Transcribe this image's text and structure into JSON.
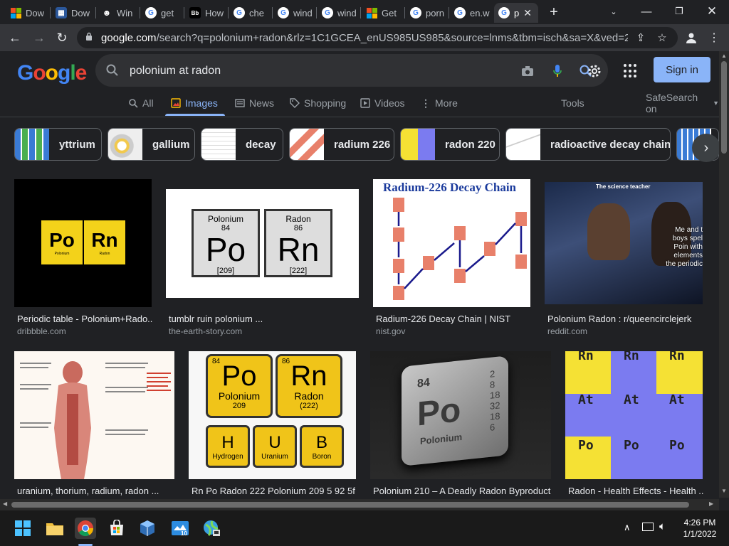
{
  "tabs": [
    {
      "label": "Dow",
      "icon": "windows-icon"
    },
    {
      "label": "Dow",
      "icon": "windows-icon"
    },
    {
      "label": "Win",
      "icon": "spy-icon"
    },
    {
      "label": "get",
      "icon": "google-icon"
    },
    {
      "label": "How",
      "icon": "bb-icon"
    },
    {
      "label": "che",
      "icon": "google-icon"
    },
    {
      "label": "wind",
      "icon": "google-icon"
    },
    {
      "label": "wind",
      "icon": "google-icon"
    },
    {
      "label": "Get",
      "icon": "microsoft-icon"
    },
    {
      "label": "porn",
      "icon": "google-icon"
    },
    {
      "label": "en.w",
      "icon": "google-icon"
    },
    {
      "label": "p",
      "icon": "google-icon"
    }
  ],
  "address": {
    "host": "google.com",
    "path": "/search?q=polonium+radon&rlz=1C1GCEA_enUS985US985&source=lnms&tbm=isch&sa=X&ved=2ahU..."
  },
  "search": {
    "query": "polonium at radon"
  },
  "logo": "Google",
  "signin_label": "Sign in",
  "nav": {
    "tabs": [
      "All",
      "Images",
      "News",
      "Shopping",
      "Videos",
      "More"
    ],
    "tools": "Tools",
    "safesearch": "SafeSearch on"
  },
  "chips": [
    "yttrium",
    "gallium",
    "decay",
    "radium 226",
    "radon 220",
    "radioactive decay chain"
  ],
  "results": [
    {
      "title": "Periodic table - Polonium+Rado...",
      "source": "dribbble.com"
    },
    {
      "title": "tumblr ruin polonium ...",
      "source": "the-earth-story.com"
    },
    {
      "title": "Radium-226 Decay Chain | NIST",
      "source": "nist.gov"
    },
    {
      "title": "Polonium Radon : r/queencirclejerk",
      "source": "reddit.com"
    },
    {
      "title": "uranium, thorium, radium, radon ...",
      "source": ""
    },
    {
      "title": "Rn Po Radon 222 Polonium 209 5 92 5f ...",
      "source": ""
    },
    {
      "title": "Polonium 210 – A Deadly Radon Byproduct",
      "source": ""
    },
    {
      "title": "Radon - Health Effects - Health ...",
      "source": ""
    }
  ],
  "images": {
    "dribbble": {
      "el1": "Po",
      "el2": "Rn",
      "n1": "Polonium",
      "n2": "Radon"
    },
    "tumblr": {
      "name1": "Polonium",
      "num1": "84",
      "sym1": "Po",
      "mass1": "[209]",
      "name2": "Radon",
      "num2": "86",
      "sym2": "Rn",
      "mass2": "[222]"
    },
    "nist": {
      "title": "Radium-226 Decay Chain"
    },
    "reddit": {
      "caption": "The science teacher",
      "overlay": "Me and t boys spel Poin with elements the periodic"
    },
    "tiles": {
      "po": "Po",
      "polonium": "Polonium",
      "po_mass": "209",
      "rn": "Rn",
      "radon": "Radon",
      "rn_mass": "(222)",
      "h": "H",
      "hydrogen": "Hydrogen",
      "u": "U",
      "uranium": "Uranium",
      "b": "B",
      "boron": "Boron",
      "po_num": "84",
      "rn_num": "86"
    },
    "cube": {
      "num": "84",
      "sym": "Po",
      "name": "Polonium",
      "shells": "2 8 18 32 18 6"
    },
    "grid": {
      "r1": "Rn",
      "r2": "At",
      "r3": "Po"
    }
  },
  "clock": {
    "time": "4:26 PM",
    "date": "1/1/2022"
  }
}
